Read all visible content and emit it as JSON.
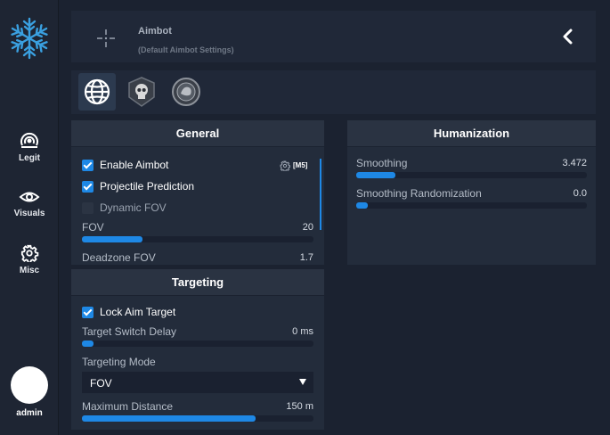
{
  "sidebar": {
    "logo_icon": "snowflake-icon",
    "items": [
      {
        "label": "Legit",
        "icon": "target-icon"
      },
      {
        "label": "Visuals",
        "icon": "eye-icon"
      },
      {
        "label": "Misc",
        "icon": "gear-icon"
      }
    ],
    "user": "admin"
  },
  "header": {
    "title": "Aimbot",
    "subtitle": "(Default Aimbot Settings)",
    "back_icon": "chevron-left-icon"
  },
  "tabs": [
    {
      "icon": "globe-icon",
      "active": true
    },
    {
      "icon": "skull-badge-icon",
      "active": false
    },
    {
      "icon": "round-emblem-icon",
      "active": false
    }
  ],
  "general": {
    "title": "General",
    "enable_aimbot": {
      "label": "Enable Aimbot",
      "checked": true,
      "key": "[M5]"
    },
    "projectile_prediction": {
      "label": "Projectile Prediction",
      "checked": true
    },
    "dynamic_fov": {
      "label": "Dynamic FOV",
      "checked": false
    },
    "fov": {
      "label": "FOV",
      "value": "20",
      "fraction": 0.26
    },
    "deadzone_fov": {
      "label": "Deadzone FOV",
      "value": "1.7"
    }
  },
  "targeting": {
    "title": "Targeting",
    "lock_aim_target": {
      "label": "Lock Aim Target",
      "checked": true
    },
    "switch_delay": {
      "label": "Target Switch Delay",
      "value": "0 ms",
      "fraction": 0.05
    },
    "mode": {
      "label": "Targeting Mode",
      "selected": "FOV"
    },
    "max_distance": {
      "label": "Maximum Distance",
      "value": "150 m",
      "fraction": 0.75
    }
  },
  "humanization": {
    "title": "Humanization",
    "smoothing": {
      "label": "Smoothing",
      "value": "3.472",
      "fraction": 0.17
    },
    "smoothing_randomization": {
      "label": "Smoothing Randomization",
      "value": "0.0",
      "fraction": 0.05
    }
  },
  "colors": {
    "accent": "#1e88e5",
    "background": "#1b2230",
    "panel": "#232c3b"
  }
}
